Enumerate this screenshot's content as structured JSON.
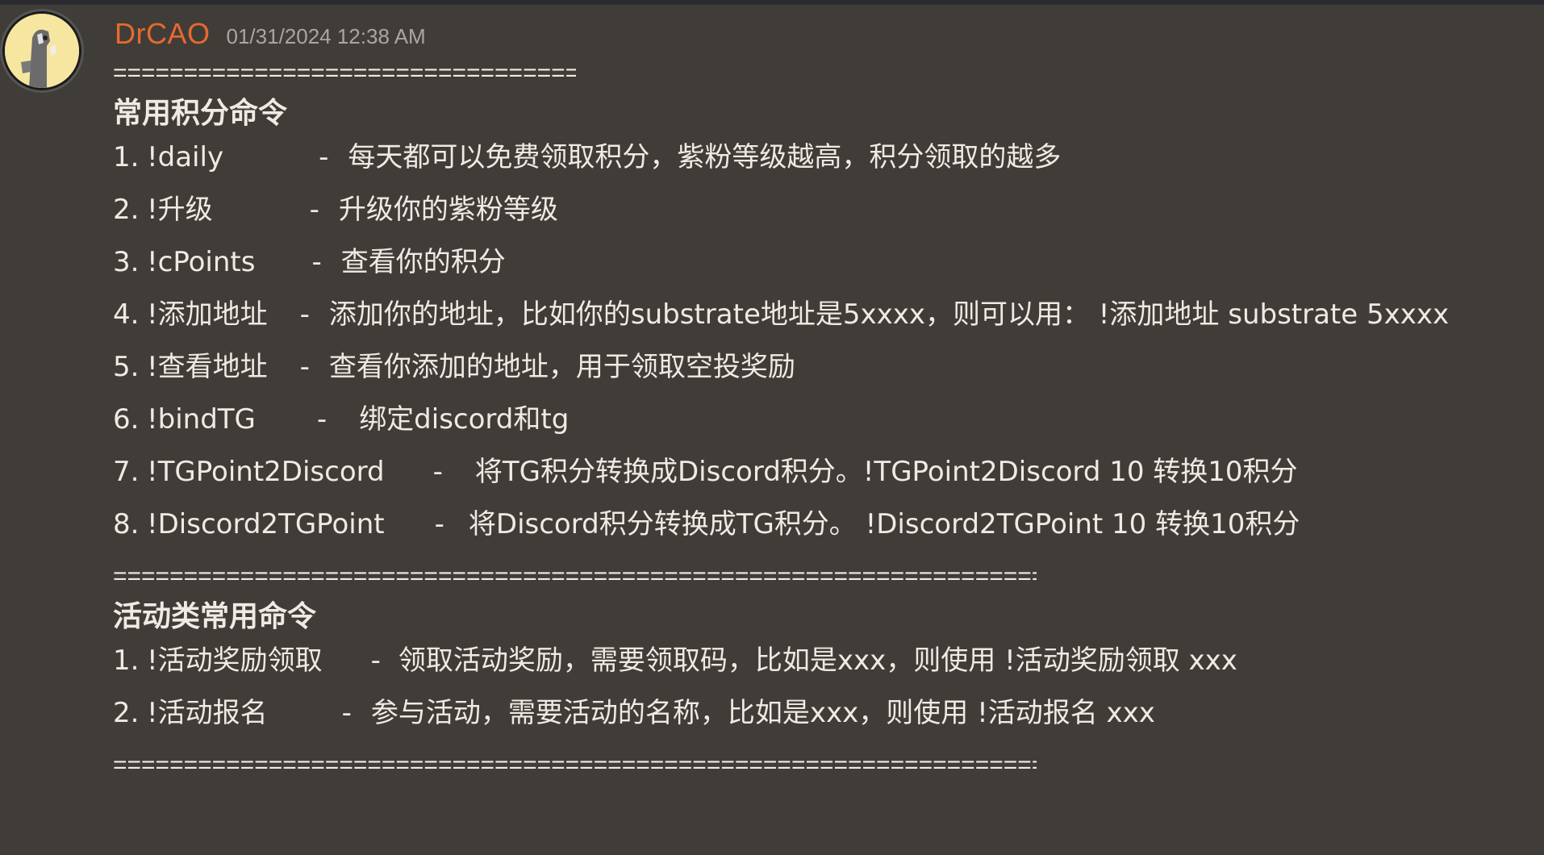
{
  "message": {
    "username": "DrCAO",
    "timestamp": "01/31/2024 12:38 AM",
    "separator_short": "=================================",
    "separator_long": "=============================================================================",
    "section1": {
      "heading": "常用积分命令",
      "items": [
        {
          "num": "1.",
          "cmd": "!daily",
          "dash": "-",
          "desc": "每天都可以免费领取积分，紫粉等级越高，积分领取的越多"
        },
        {
          "num": "2.",
          "cmd": "!升级",
          "dash": "-",
          "desc": "升级你的紫粉等级"
        },
        {
          "num": "3.",
          "cmd": "!cPoints",
          "dash": "-",
          "desc": "查看你的积分"
        },
        {
          "num": "4.",
          "cmd": "!添加地址",
          "dash": "-",
          "desc": "添加你的地址，比如你的substrate地址是5xxxx，则可以用：   !添加地址 substrate 5xxxx"
        },
        {
          "num": "5.",
          "cmd": "!查看地址",
          "dash": "-",
          "desc": "查看你添加的地址，用于领取空投奖励"
        },
        {
          "num": "6.",
          "cmd": "!bindTG",
          "dash": "-",
          "desc": "绑定discord和tg"
        },
        {
          "num": "7.",
          "cmd": "!TGPoint2Discord",
          "dash": "-",
          "desc": "将TG积分转换成Discord积分。!TGPoint2Discord 10 转换10积分"
        },
        {
          "num": "8.",
          "cmd": "!Discord2TGPoint",
          "dash": "-",
          "desc": "将Discord积分转换成TG积分。 !Discord2TGPoint 10 转换10积分"
        }
      ]
    },
    "section2": {
      "heading": "活动类常用命令",
      "items": [
        {
          "num": "1.",
          "cmd": "!活动奖励领取",
          "dash": "-",
          "desc": "领取活动奖励，需要领取码，比如是xxx，则使用 !活动奖励领取 xxx"
        },
        {
          "num": "2.",
          "cmd": "!活动报名",
          "dash": "-",
          "desc": "参与活动，需要活动的名称，比如是xxx，则使用 !活动报名 xxx"
        }
      ]
    }
  },
  "colors": {
    "background": "#403d39",
    "username": "#e56a2e",
    "timestamp": "#a9a6a1",
    "text": "#eeeae4"
  },
  "icons": {
    "avatar": "avatar-image"
  }
}
